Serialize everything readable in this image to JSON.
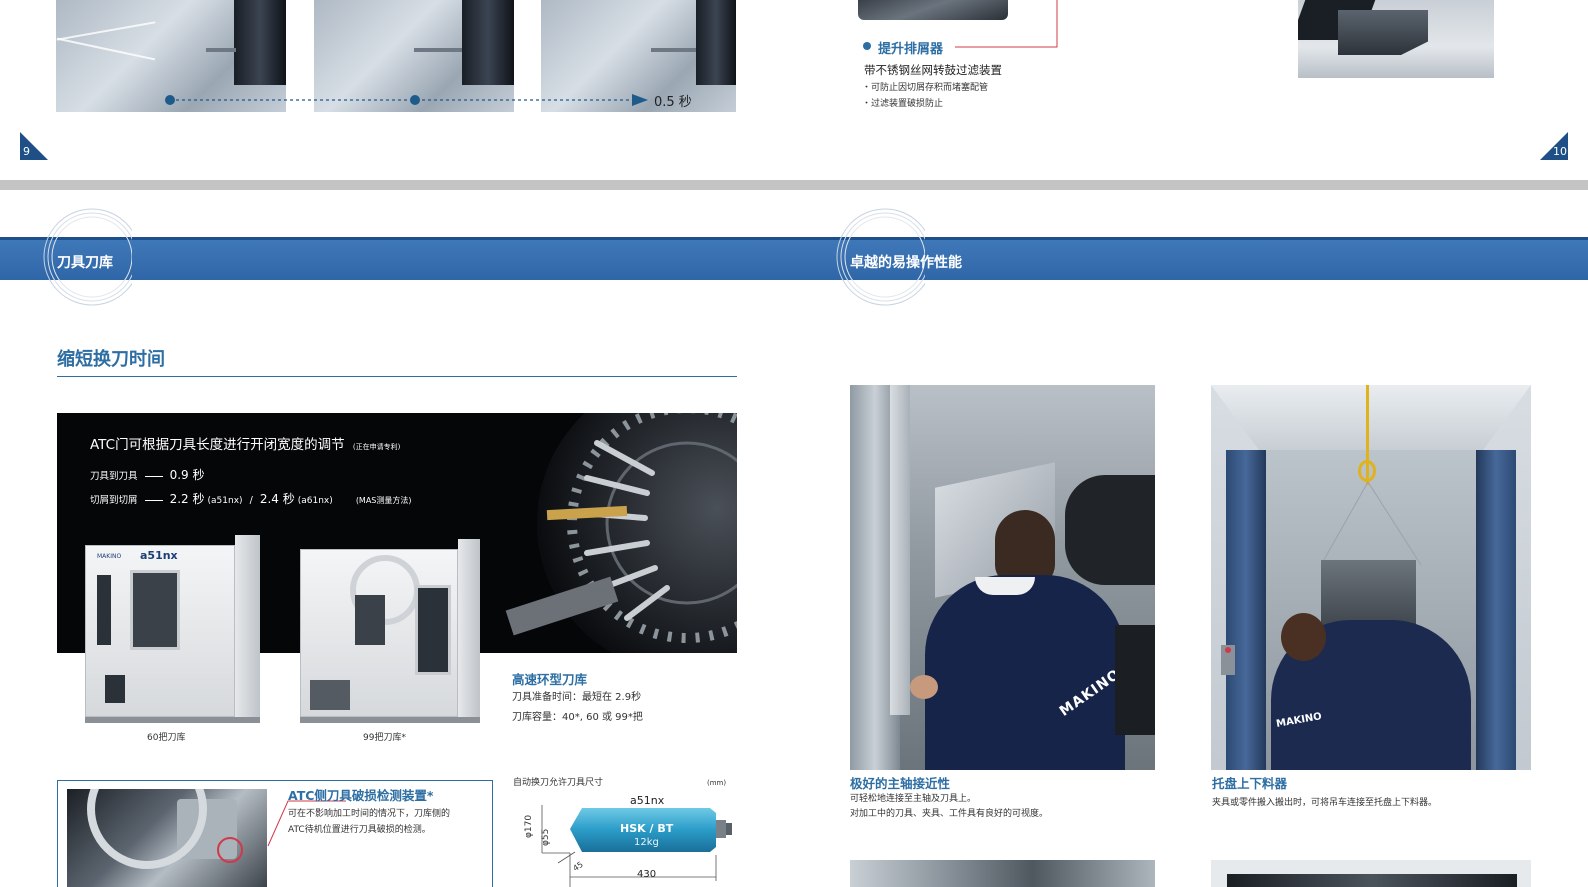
{
  "top": {
    "time_label": "0.5 秒",
    "page_left": "9",
    "page_right": "10",
    "chip": {
      "title": "提升排屑器",
      "subtitle": "带不锈钢丝网转鼓过滤装置",
      "bullets": [
        "・可防止因切屑存积而堵塞配管",
        "・过滤装置破损防止"
      ]
    }
  },
  "headers": {
    "left": "刀具刀库",
    "right": "卓越的易操作性能"
  },
  "left": {
    "section_title": "缩短换刀时间",
    "atc_title": "ATC门可根据刀具长度进行开闭宽度的调节",
    "atc_note": "(正在申请专利)",
    "spec1_label": "刀具到刀具",
    "spec1_value": "0.9 秒",
    "spec2_label": "切屑到切屑",
    "spec2_value1": "2.2 秒",
    "spec2_model1": "(a51nx)",
    "spec2_sep": "/",
    "spec2_value2": "2.4 秒",
    "spec2_model2": "(a61nx)",
    "spec2_method": "(MAS测量方法)",
    "machine1_brand": "MAKINO",
    "machine1_model": "a51nx",
    "caption_60": "60把刀库",
    "caption_99": "99把刀库*",
    "ring_title": "高速环型刀库",
    "ring_line1": "刀具准备时间：最短在 2.9秒",
    "ring_line2": "刀库容量：40*, 60 或 99*把",
    "detect_title": "ATC侧刀具破损检测装置*",
    "detect_line1": "可在不影响加工时间的情况下，刀库侧的",
    "detect_line2": "ATC待机位置进行刀具破损的检测。",
    "tool_dims_title": "自动换刀允许刀具尺寸",
    "tool_dims_unit": "(mm)",
    "tool_model": "a51nx",
    "tool_type": "HSK / BT",
    "tool_weight": "12kg",
    "dim_170": "φ170",
    "dim_55": "φ55",
    "dim_45": "45",
    "dim_430": "430"
  },
  "right": {
    "photo1_title": "极好的主轴接近性",
    "photo1_line1": "可轻松地连接至主轴及刀具上。",
    "photo1_line2": "对加工中的刀具、夹具、工件具有良好的可视度。",
    "photo2_title": "托盘上下料器",
    "photo2_line1": "夹具或零件搬入搬出时，可将吊车连接至托盘上下料器。",
    "logo_text": "MAKINO"
  },
  "colors": {
    "accent": "#2d6ea3",
    "band": "#3470b2",
    "navy": "#1e3f74"
  }
}
